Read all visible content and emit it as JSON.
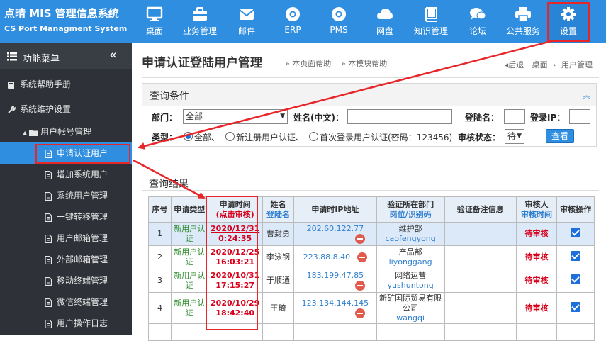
{
  "brand": {
    "title": "点晴 MIS 管理信息系统",
    "subtitle": "CS Port Managment System"
  },
  "nav": [
    {
      "label": "桌面",
      "icon": "desktop-icon"
    },
    {
      "label": "业务管理",
      "icon": "briefcase-icon"
    },
    {
      "label": "邮件",
      "icon": "mail-icon"
    },
    {
      "label": "ERP",
      "icon": "chrome-icon"
    },
    {
      "label": "PMS",
      "icon": "chrome-icon"
    },
    {
      "label": "网盘",
      "icon": "cloud-icon"
    },
    {
      "label": "知识管理",
      "icon": "book-icon"
    },
    {
      "label": "论坛",
      "icon": "chat-icon"
    },
    {
      "label": "公共服务",
      "icon": "printer-icon"
    },
    {
      "label": "设置",
      "icon": "gear-icon"
    }
  ],
  "sidebar": {
    "header": "功能菜单",
    "collapse": "«",
    "items": [
      {
        "label": "系统帮助手册"
      },
      {
        "label": "系统维护设置"
      },
      {
        "label": "用户帐号管理"
      },
      {
        "label": "申请认证用户"
      },
      {
        "label": "增加系统用户"
      },
      {
        "label": "系统用户管理"
      },
      {
        "label": "一键转移管理"
      },
      {
        "label": "用户邮箱管理"
      },
      {
        "label": "外部邮箱管理"
      },
      {
        "label": "移动终端管理"
      },
      {
        "label": "微信终端管理"
      },
      {
        "label": "用户操作日志"
      }
    ]
  },
  "page": {
    "title": "申请认证登陆用户管理",
    "help_page": "» 本页面帮助",
    "help_module": "» 本模块帮助",
    "back": "◂后退",
    "crumb1": "桌面",
    "crumb_sep": "›",
    "crumb2": "用户管理"
  },
  "query": {
    "title": "查询条件",
    "dept_label": "部门：",
    "dept_value": "全部",
    "name_label": "姓名(中文)：",
    "login_label": "登陆名：",
    "loginip_label": "登录IP：",
    "type_label": "类型：",
    "radio_all": "全部、",
    "radio_new": "新注册用户认证、",
    "radio_first": "首次登录用户认证(密码：123456)",
    "status_label": "审核状态：",
    "status_value": "待",
    "search_btn": "查看"
  },
  "results": {
    "title": "查询结果",
    "headers": {
      "no": "序号",
      "type": "申请类型",
      "time": "申请时间",
      "time_sub": "(点击审核)",
      "name": "姓名",
      "name_sub": "登陆名",
      "ip": "申请时IP地址",
      "dept": "验证所在部门",
      "dept_sub": "岗位/识别码",
      "note": "验证备注信息",
      "auditor": "审核人",
      "auditor_sub": "审核时间",
      "op": "审核操作"
    },
    "rows": [
      {
        "no": "1",
        "type": "新用户认证",
        "date": "2020/12/31",
        "time": "0:24:35",
        "name": "曹封勇",
        "ip": "202.60.122.77",
        "dept": "维护部",
        "login": "caofengyong",
        "status": "待审核"
      },
      {
        "no": "2",
        "type": "新用户认证",
        "date": "2020/12/25",
        "time": "16:03:21",
        "name": "李泳钢",
        "ip": "223.88.8.40",
        "dept": "产品部",
        "login": "liyonggang",
        "status": "待审核"
      },
      {
        "no": "3",
        "type": "新用户认证",
        "date": "2020/10/31",
        "time": "17:15:27",
        "name": "于顺通",
        "ip": "183.199.47.85",
        "dept": "网络运营",
        "login": "yushuntong",
        "status": "待审核"
      },
      {
        "no": "4",
        "type": "新用户认证",
        "date": "2020/10/29",
        "time": "18:42:40",
        "name": "王琦",
        "ip": "123.134.144.145",
        "dept": "新矿国际贸易有限公司",
        "login": "wangqi",
        "status": "待审核"
      }
    ]
  },
  "colors": {
    "primary": "#2f8ee0",
    "sidebar": "#2e3238",
    "highlight": "#e8262a"
  }
}
